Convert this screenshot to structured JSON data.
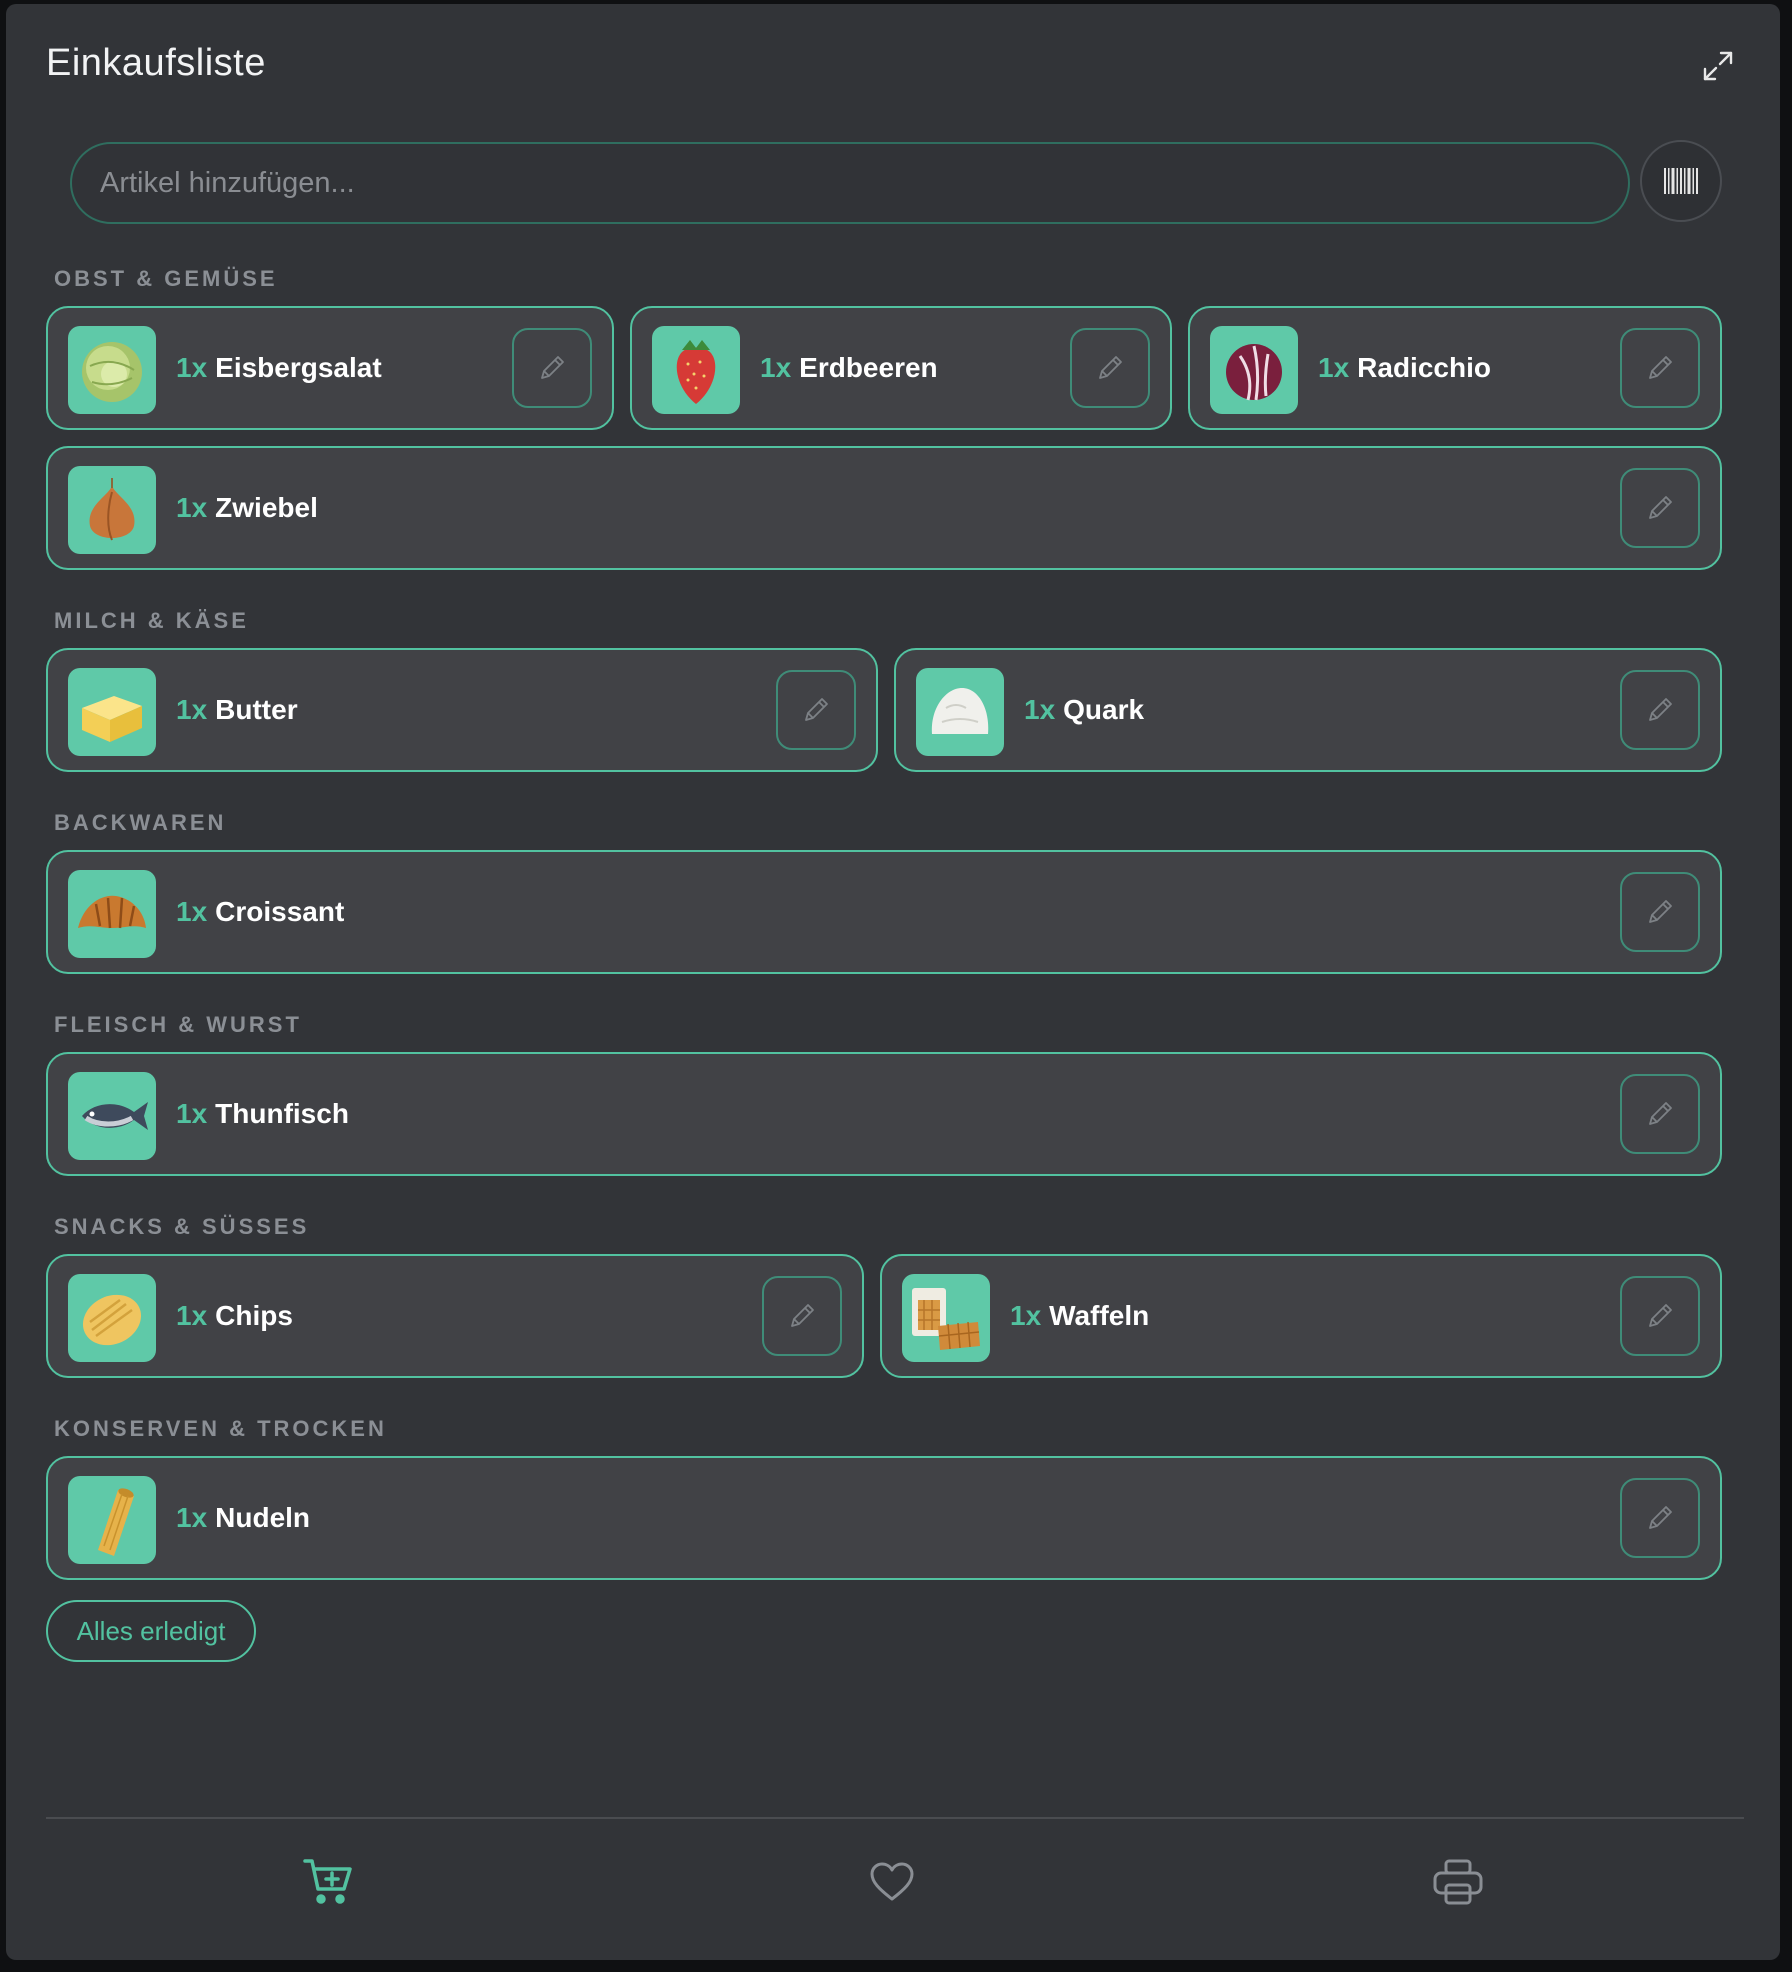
{
  "header": {
    "title": "Einkaufsliste"
  },
  "search": {
    "placeholder": "Artikel hinzufügen..."
  },
  "categories": [
    {
      "label": "OBST & GEMÜSE",
      "items": [
        {
          "qty": "1x",
          "name": "Eisbergsalat",
          "icon": "lettuce-icon"
        },
        {
          "qty": "1x",
          "name": "Erdbeeren",
          "icon": "strawberry-icon"
        },
        {
          "qty": "1x",
          "name": "Radicchio",
          "icon": "radicchio-icon"
        },
        {
          "qty": "1x",
          "name": "Zwiebel",
          "icon": "onion-icon"
        }
      ]
    },
    {
      "label": "MILCH & KÄSE",
      "items": [
        {
          "qty": "1x",
          "name": "Butter",
          "icon": "butter-icon"
        },
        {
          "qty": "1x",
          "name": "Quark",
          "icon": "quark-icon"
        }
      ]
    },
    {
      "label": "BACKWAREN",
      "items": [
        {
          "qty": "1x",
          "name": "Croissant",
          "icon": "croissant-icon"
        }
      ]
    },
    {
      "label": "FLEISCH & WURST",
      "items": [
        {
          "qty": "1x",
          "name": "Thunfisch",
          "icon": "tuna-icon"
        }
      ]
    },
    {
      "label": "SNACKS & SÜSSES",
      "items": [
        {
          "qty": "1x",
          "name": "Chips",
          "icon": "chips-icon"
        },
        {
          "qty": "1x",
          "name": "Waffeln",
          "icon": "waffle-icon"
        }
      ]
    },
    {
      "label": "KONSERVEN & TROCKEN",
      "items": [
        {
          "qty": "1x",
          "name": "Nudeln",
          "icon": "pasta-icon"
        }
      ]
    }
  ],
  "actions": {
    "done_label": "Alles erledigt"
  },
  "nav": [
    {
      "icon": "cart-add-icon",
      "active": true
    },
    {
      "icon": "heart-icon",
      "active": false
    },
    {
      "icon": "printer-icon",
      "active": false
    }
  ],
  "colors": {
    "accent": "#52c2a0",
    "background": "#323438",
    "card": "#414246",
    "thumb": "#5fc9a8"
  }
}
